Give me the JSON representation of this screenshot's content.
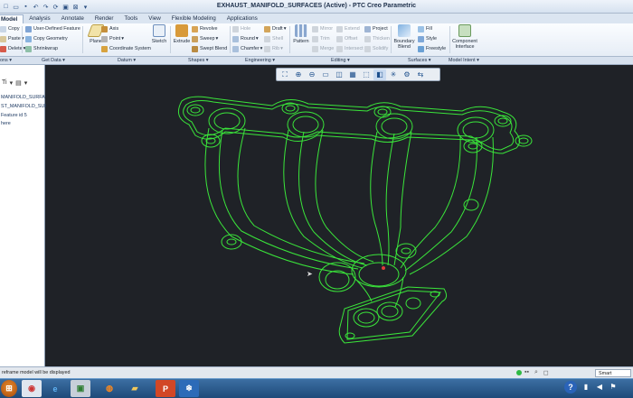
{
  "window": {
    "title": "EXHAUST_MANIFOLD_SURFACES (Active) - PTC Creo Parametric"
  },
  "tabs": [
    {
      "label": "Model",
      "active": true
    },
    {
      "label": "Analysis"
    },
    {
      "label": "Annotate"
    },
    {
      "label": "Render"
    },
    {
      "label": "Tools"
    },
    {
      "label": "View"
    },
    {
      "label": "Flexible Modeling"
    },
    {
      "label": "Applications"
    }
  ],
  "ribbon": {
    "operations": {
      "copy": "Copy",
      "paste": "Paste",
      "delete": "Delete"
    },
    "get_data": {
      "udf": "User-Defined Feature",
      "copy_geometry": "Copy Geometry",
      "shrinkwrap": "Shrinkwrap"
    },
    "datum": {
      "plane": "Plane",
      "axis": "Axis",
      "point": "Point",
      "csys": "Coordinate System",
      "sketch": "Sketch"
    },
    "shapes": {
      "extrude": "Extrude",
      "revolve": "Revolve",
      "sweep": "Sweep",
      "swept_blend": "Swept Blend"
    },
    "engineering": {
      "hole": "Hole",
      "round": "Round",
      "chamfer": "Chamfer",
      "draft": "Draft",
      "shell": "Shell",
      "rib": "Rib"
    },
    "editing": {
      "pattern": "Pattern",
      "mirror": "Mirror",
      "trim": "Trim",
      "merge": "Merge",
      "extend": "Extend",
      "offset": "Offset",
      "intersect": "Intersect",
      "project": "Project",
      "thicken": "Thicken",
      "solidify": "Solidify"
    },
    "surfaces": {
      "boundary_blend": "Boundary Blend",
      "fill": "Fill",
      "style": "Style",
      "freestyle": "Freestyle"
    },
    "model_intent": {
      "component_interface": "Component Interface"
    }
  },
  "group_labels": {
    "operations": "ons ▾",
    "get_data": "Get Data ▾",
    "datum": "Datum ▾",
    "shapes": "Shapes ▾",
    "engineering": "Engineering ▾",
    "editing": "Editing ▾",
    "surfaces": "Surfaces ▾",
    "model_intent": "Model Intent ▾"
  },
  "model_tree": {
    "items": [
      "MANIFOLD_SURFA",
      "ST_MANIFOLD_SUR",
      "Feature id 5",
      "here"
    ]
  },
  "graphics_toolbar": {
    "icons": [
      "refit-icon",
      "zoom-in-icon",
      "zoom-out-icon",
      "repaint-icon",
      "spin-center-icon",
      "named-views-icon",
      "saved-orientations-icon",
      "display-style-icon",
      "datum-display-icon",
      "annotation-display-icon",
      "appearance-icon"
    ]
  },
  "status": {
    "message": "reframe model will be displayed",
    "filter": "Smart"
  },
  "colors": {
    "wireframe": "#3cf03c",
    "background": "#1f2227"
  },
  "taskbar": {
    "apps": [
      "windows-explorer",
      "chrome",
      "internet-explorer",
      "creo",
      "firefox",
      "file-explorer",
      "camtasia",
      "powerpoint",
      "creo-parametric"
    ]
  }
}
